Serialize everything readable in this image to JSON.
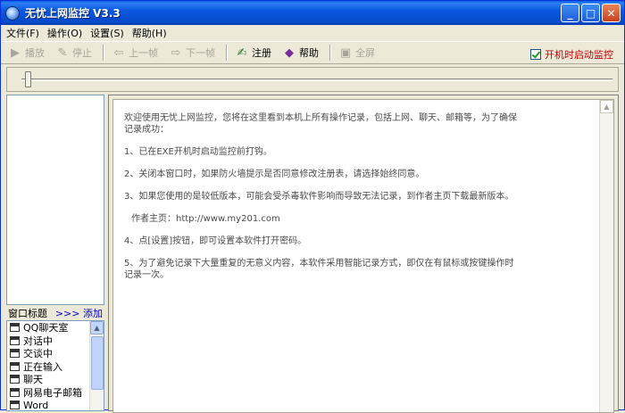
{
  "window": {
    "title": "无忧上网监控  V3.3"
  },
  "titlebar_buttons": {
    "minimize": "_",
    "maximize": "□",
    "close": "✕"
  },
  "menu": [
    "文件(F)",
    "操作(O)",
    "设置(S)",
    "帮助(H)"
  ],
  "toolbar": {
    "play": "播放",
    "stop": "停止",
    "prev": "上一帧",
    "next": "下一帧",
    "register": "注册",
    "help": "帮助",
    "fullscreen": "全屏",
    "autostart": "开机时启动监控",
    "autostart_checked": true
  },
  "left_panel": {
    "header": "窗口标题",
    "add": ">>> 添加",
    "items": [
      "QQ聊天室",
      "对话中",
      "交谈中",
      "正在输入",
      "聊天",
      "网易电子邮箱",
      "Word"
    ]
  },
  "content": {
    "paragraphs": [
      "欢迎使用无忧上网监控，您将在这里看到本机上所有操作记录，包括上网、聊天、邮箱等，为了确保记录成功：",
      "1、已在EXE开机时启动监控前打钩。",
      "2、关闭本窗口时，如果防火墙提示是否同意修改注册表，请选择始终同意。",
      "3、如果您使用的是较低版本，可能会受杀毒软件影响而导致无法记录，到作者主页下载最新版本。",
      "作者主页：http://www.my201.com",
      "4、点[设置]按钮，即可设置本软件打开密码。",
      "5、为了避免记录下大量重复的无意义内容，本软件采用智能记录方式，即仅在有鼠标或按键操作时记录一次。"
    ]
  },
  "colors": {
    "autostart_text": "#c00000",
    "add_link": "#0000cc",
    "titlebar": "#0a58e0"
  }
}
